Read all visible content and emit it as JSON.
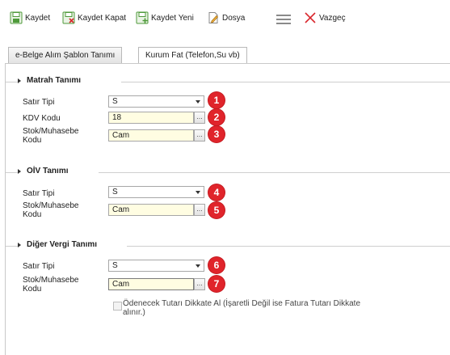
{
  "toolbar": {
    "save_label": "Kaydet",
    "save_close_label": "Kaydet Kapat",
    "save_new_label": "Kaydet Yeni",
    "file_label": "Dosya",
    "cancel_label": "Vazgeç",
    "colors": {
      "save_green": "#4e9a3a",
      "cancel_red": "#d9262c"
    }
  },
  "tabs": [
    {
      "label": "e-Belge Alım Şablon Tanımı",
      "active": false
    },
    {
      "label": "Kurum Fat (Telefon,Su vb)",
      "active": true
    }
  ],
  "sections": [
    {
      "title": "Matrah Tanımı",
      "fields": [
        {
          "label": "Satır Tipi",
          "type": "select",
          "value": "S",
          "badge": "1"
        },
        {
          "label": "KDV Kodu",
          "type": "lookup",
          "value": "18",
          "badge": "2"
        },
        {
          "label": "Stok/Muhasebe Kodu",
          "type": "lookup",
          "value": "Cam",
          "badge": "3"
        }
      ]
    },
    {
      "title": "OİV Tanımı",
      "fields": [
        {
          "label": "Satır Tipi",
          "type": "select",
          "value": "S",
          "badge": "4"
        },
        {
          "label": "Stok/Muhasebe Kodu",
          "type": "lookup",
          "value": "Cam",
          "badge": "5"
        }
      ]
    },
    {
      "title": "Diğer Vergi Tanımı",
      "fields": [
        {
          "label": "Satır Tipi",
          "type": "select",
          "value": "S",
          "badge": "6"
        },
        {
          "label": "Stok/Muhasebe Kodu",
          "type": "lookup",
          "value": "Cam",
          "badge": "7"
        }
      ]
    }
  ],
  "lookup_button_label": "...",
  "checkbox": {
    "label": "Ödenecek Tutarı Dikkate Al (İşaretli Değil ise Fatura Tutarı Dikkate alınır.)",
    "checked": false
  },
  "badge_color": "#e0242b",
  "input_bg": "#fffde2"
}
